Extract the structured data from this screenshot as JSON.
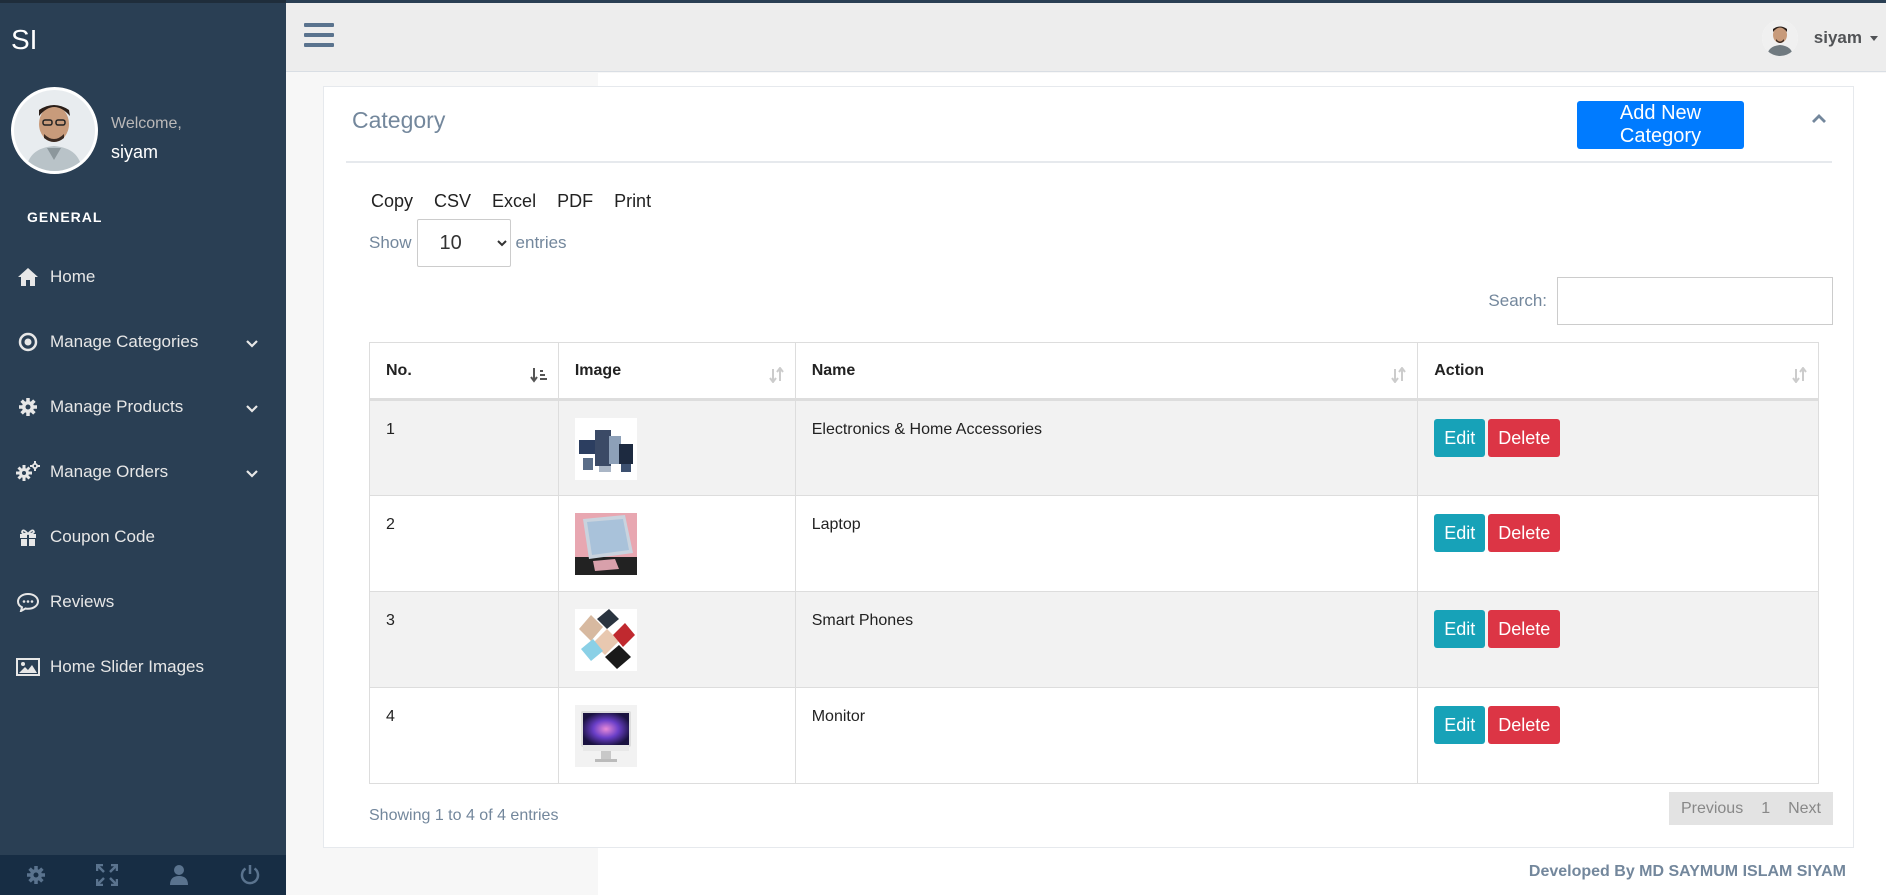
{
  "sidebar": {
    "brand": "SI",
    "welcome": "Welcome,",
    "username": "siyam",
    "section": "GENERAL",
    "items": [
      {
        "label": "Home",
        "icon": "home-icon"
      },
      {
        "label": "Manage Categories",
        "icon": "target-icon",
        "has_submenu": true
      },
      {
        "label": "Manage Products",
        "icon": "gear-icon",
        "has_submenu": true
      },
      {
        "label": "Manage Orders",
        "icon": "gears-icon",
        "has_submenu": true
      },
      {
        "label": "Coupon Code",
        "icon": "gift-icon"
      },
      {
        "label": "Reviews",
        "icon": "comment-icon"
      },
      {
        "label": "Home Slider Images",
        "icon": "image-icon"
      }
    ],
    "footer_icons": [
      "settings-icon",
      "fullscreen-icon",
      "user-icon",
      "power-icon"
    ]
  },
  "topnav": {
    "username": "siyam"
  },
  "panel": {
    "title": "Category",
    "add_button": "Add New Category",
    "export_buttons": [
      "Copy",
      "CSV",
      "Excel",
      "PDF",
      "Print"
    ],
    "show_label": "Show",
    "entries_label": "entries",
    "page_length": "10",
    "search_label": "Search:",
    "search_value": ""
  },
  "table": {
    "columns": [
      "No.",
      "Image",
      "Name",
      "Action"
    ],
    "rows": [
      {
        "no": "1",
        "name": "Electronics & Home Accessories",
        "image": "electronics-thumbnail"
      },
      {
        "no": "2",
        "name": "Laptop",
        "image": "laptop-thumbnail"
      },
      {
        "no": "3",
        "name": "Smart Phones",
        "image": "smartphones-thumbnail"
      },
      {
        "no": "4",
        "name": "Monitor",
        "image": "monitor-thumbnail"
      }
    ],
    "edit_label": "Edit",
    "delete_label": "Delete"
  },
  "pagination": {
    "info": "Showing 1 to 4 of 4 entries",
    "previous": "Previous",
    "current": "1",
    "next": "Next"
  },
  "footer": {
    "credit": "Developed By MD SAYMUM ISLAM SIYAM"
  },
  "colors": {
    "sidebar_bg": "#2a3f54",
    "primary": "#007bff",
    "info": "#17a2b8",
    "danger": "#dc3545",
    "muted_text": "#73879c"
  }
}
